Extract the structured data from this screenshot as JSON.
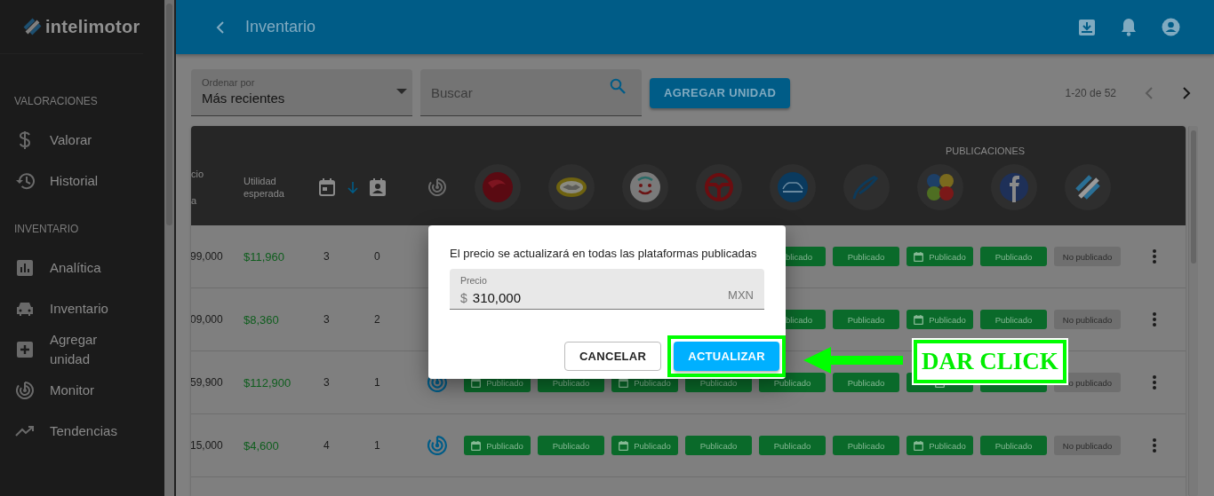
{
  "sidebar": {
    "logo": "intelimotor",
    "sections": [
      {
        "title": "VALORACIONES",
        "items": [
          {
            "label": "Valorar"
          },
          {
            "label": "Historial"
          }
        ]
      },
      {
        "title": "INVENTARIO",
        "items": [
          {
            "label": "Analítica"
          },
          {
            "label": "Inventario"
          },
          {
            "label": "Agregar unidad"
          },
          {
            "label": "Monitor"
          },
          {
            "label": "Tendencias"
          }
        ]
      }
    ]
  },
  "topbar": {
    "title": "Inventario"
  },
  "toolbar": {
    "sort": {
      "label": "Ordenar por",
      "value": "Más recientes"
    },
    "search": {
      "placeholder": "Buscar"
    },
    "add_button": "AGREGAR UNIDAD",
    "pagination": "1-20 de 52"
  },
  "table": {
    "column_1": [
      "cio",
      "a"
    ],
    "column_2": "Utilidad esperada",
    "group_header": "PUBLICACIONES",
    "rows": [
      {
        "column_1": "99,000",
        "profit": "$11,960",
        "column_3": "3",
        "column_4": "0",
        "pubs": [
          {
            "kind": "published",
            "label": "blicado",
            "cut": true
          },
          {
            "kind": "published",
            "label": "Publicado"
          },
          {
            "kind": "scheduled",
            "label": "Publicado"
          },
          {
            "kind": "published",
            "label": "Publicado"
          },
          {
            "kind": "unpublished",
            "label": "No publicado"
          }
        ]
      },
      {
        "column_1": "09,000",
        "profit": "$8,360",
        "column_3": "3",
        "column_4": "2",
        "pubs": [
          {
            "kind": "published",
            "label": "blicado",
            "cut": true
          },
          {
            "kind": "published",
            "label": "Publicado"
          },
          {
            "kind": "scheduled",
            "label": "Publicado"
          },
          {
            "kind": "published",
            "label": "Publicado"
          },
          {
            "kind": "unpublished",
            "label": "No publicado"
          }
        ]
      },
      {
        "column_1": "59,900",
        "profit": "$112,900",
        "column_3": "3",
        "column_4": "1",
        "monitor": true,
        "pubs": [
          {
            "kind": "scheduled",
            "label": "Publicado"
          },
          {
            "kind": "published",
            "label": "Publicado"
          },
          {
            "kind": "scheduled",
            "label": "Publicado"
          },
          {
            "kind": "published",
            "label": "Publicado"
          },
          {
            "kind": "published",
            "label": "Publicado"
          },
          {
            "kind": "published",
            "label": "Publicado"
          },
          {
            "kind": "scheduled"
          },
          {
            "kind": "published"
          },
          {
            "kind": "unpublished",
            "label": "o publicado",
            "cut": true
          }
        ]
      },
      {
        "column_1": "15,000",
        "profit": "$4,600",
        "column_3": "4",
        "column_4": "1",
        "monitor": true,
        "pubs": [
          {
            "kind": "scheduled",
            "label": "Publicado"
          },
          {
            "kind": "published",
            "label": "Publicado"
          },
          {
            "kind": "scheduled",
            "label": "Publicado"
          },
          {
            "kind": "published",
            "label": "Publicado"
          },
          {
            "kind": "published",
            "label": "Publicado"
          },
          {
            "kind": "published",
            "label": "Publicado"
          },
          {
            "kind": "scheduled",
            "label": "Publicado"
          },
          {
            "kind": "published",
            "label": "Publicado"
          },
          {
            "kind": "unpublished",
            "label": "No publicado"
          }
        ]
      }
    ]
  },
  "dialog": {
    "message": "El precio se actualizará en todas las plataformas publicadas",
    "field": {
      "label": "Precio",
      "prefix": "$",
      "value": "310,000",
      "suffix": "MXN"
    },
    "buttons": [
      {
        "label": "CANCELAR",
        "kind": "outlined",
        "highlighted": false
      },
      {
        "label": "ACTUALIZAR",
        "kind": "primary",
        "highlighted": true
      }
    ]
  },
  "annotation": {
    "text": "DAR CLICK"
  }
}
